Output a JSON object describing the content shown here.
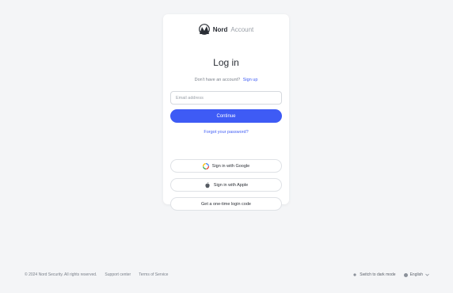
{
  "brand": {
    "name": "Nord",
    "sub": "Account"
  },
  "login": {
    "title": "Log in",
    "signup_prompt": "Don't have an account?",
    "signup_link": "Sign up",
    "email_placeholder": "Email address",
    "continue_label": "Continue",
    "forgot_label": "Forgot your password?",
    "google_label": "Sign in with Google",
    "apple_label": "Sign in with Apple",
    "code_label": "Get a one-time login code"
  },
  "footer": {
    "copyright": "© 2024 Nord Security. All rights reserved.",
    "support": "Support center",
    "terms": "Terms of Service",
    "theme": "Switch to dark mode",
    "language": "English"
  },
  "colors": {
    "accent": "#3e5bf5",
    "background": "#f4f5f7"
  },
  "icons": [
    "nord-logo-icon",
    "google-icon",
    "apple-icon",
    "sun-icon",
    "globe-icon",
    "chevron-down-icon"
  ]
}
